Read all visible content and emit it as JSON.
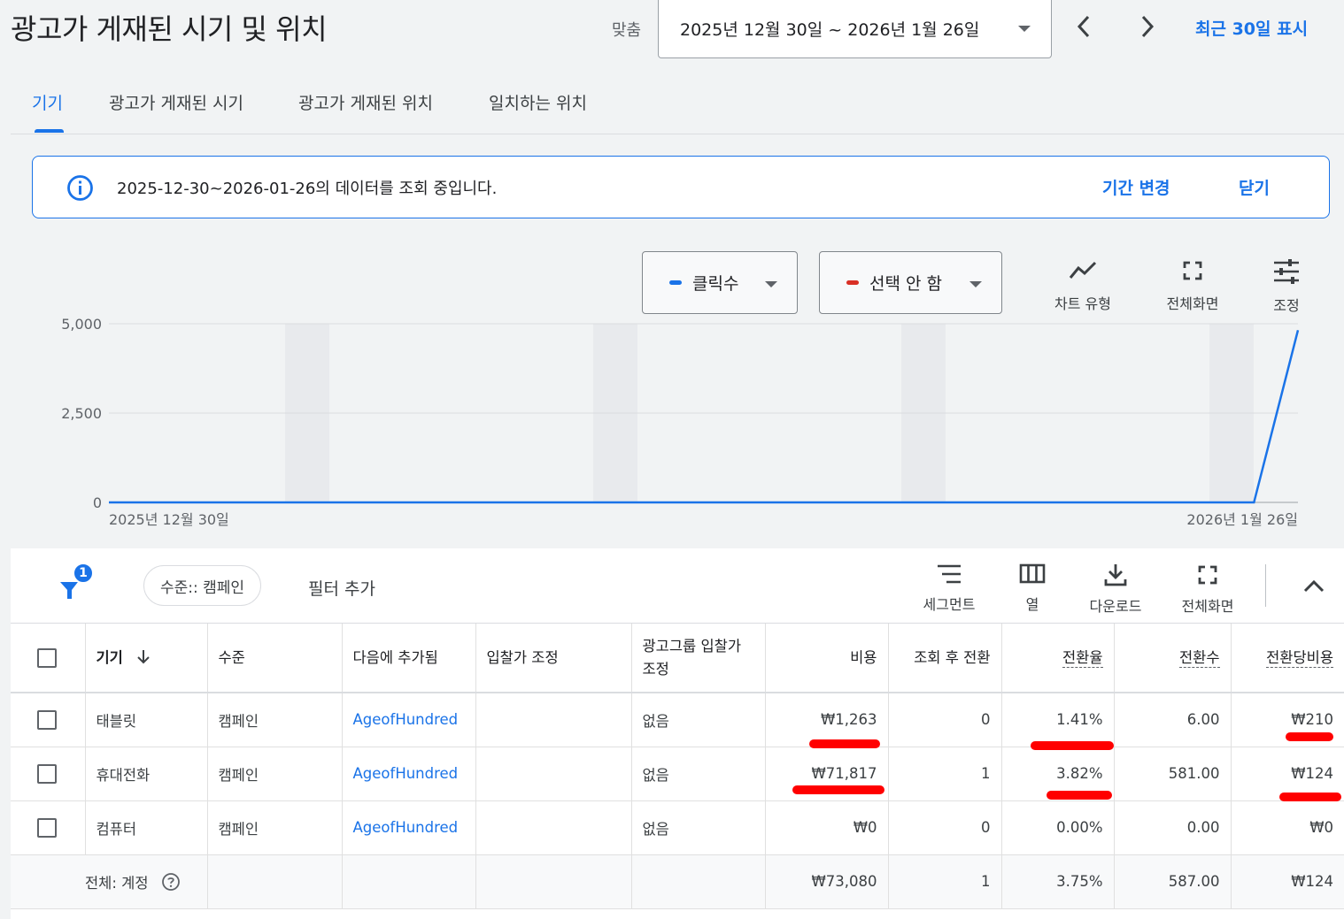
{
  "header": {
    "title": "광고가 게재된 시기 및 위치",
    "match_label": "맞춤",
    "date_range": "2025년 12월 30일 ~ 2026년 1월 26일",
    "recent_link": "최근 30일 표시"
  },
  "tabs": [
    {
      "label": "기기",
      "active": true
    },
    {
      "label": "광고가 게재된 시기",
      "active": false
    },
    {
      "label": "광고가 게재된 위치",
      "active": false
    },
    {
      "label": "일치하는 위치",
      "active": false
    }
  ],
  "banner": {
    "text": "2025-12-30~2026-01-26의 데이터를 조회 중입니다.",
    "change_period": "기간 변경",
    "close": "닫기"
  },
  "chart_controls": {
    "metric1": {
      "label": "클릭수",
      "color": "#1a73e8"
    },
    "metric2": {
      "label": "선택 안 함",
      "color": "#d93025"
    },
    "chart_type": "차트 유형",
    "fullscreen": "전체화면",
    "adjust": "조정"
  },
  "chart_data": {
    "type": "line",
    "x_start_label": "2025년 12월 30일",
    "x_end_label": "2026년 1월 26일",
    "y_ticks": [
      "5,000",
      "2,500",
      "0"
    ],
    "ylim": [
      0,
      5000
    ],
    "series": [
      {
        "name": "클릭수",
        "color": "#1a73e8",
        "values": [
          0,
          0,
          0,
          0,
          0,
          0,
          0,
          0,
          0,
          0,
          0,
          0,
          0,
          0,
          0,
          0,
          0,
          0,
          0,
          0,
          0,
          0,
          0,
          0,
          0,
          0,
          0,
          4820
        ]
      }
    ],
    "grid": true
  },
  "filter_bar": {
    "filter_count": "1",
    "chip": "수준:: 캠페인",
    "add_filter": "필터 추가",
    "tools": {
      "segment": "세그먼트",
      "columns": "열",
      "download": "다운로드",
      "fullscreen": "전체화면"
    }
  },
  "table": {
    "headers": {
      "device": "기기",
      "level": "수준",
      "added_to": "다음에 추가됨",
      "bid_adj": "입찰가 조정",
      "adgroup_bid_adj": "광고그룹 입찰가 조정",
      "cost": "비용",
      "view_through": "조회 후 전환",
      "conv_rate": "전환율",
      "conversions": "전환수",
      "cost_per_conv": "전환당비용"
    },
    "rows": [
      {
        "device": "태블릿",
        "level": "캠페인",
        "added_to": "AgeofHundred",
        "bid_adj": "",
        "adgroup_bid_adj": "없음",
        "cost": "₩1,263",
        "view_through": "0",
        "conv_rate": "1.41%",
        "conversions": "6.00",
        "cost_per_conv": "₩210"
      },
      {
        "device": "휴대전화",
        "level": "캠페인",
        "added_to": "AgeofHundred",
        "bid_adj": "",
        "adgroup_bid_adj": "없음",
        "cost": "₩71,817",
        "view_through": "1",
        "conv_rate": "3.82%",
        "conversions": "581.00",
        "cost_per_conv": "₩124"
      },
      {
        "device": "컴퓨터",
        "level": "캠페인",
        "added_to": "AgeofHundred",
        "bid_adj": "",
        "adgroup_bid_adj": "없음",
        "cost": "₩0",
        "view_through": "0",
        "conv_rate": "0.00%",
        "conversions": "0.00",
        "cost_per_conv": "₩0"
      }
    ],
    "total": {
      "label": "전체: 계정",
      "cost": "₩73,080",
      "view_through": "1",
      "conv_rate": "3.75%",
      "conversions": "587.00",
      "cost_per_conv": "₩124"
    }
  },
  "annotation_color": "#ff0000"
}
